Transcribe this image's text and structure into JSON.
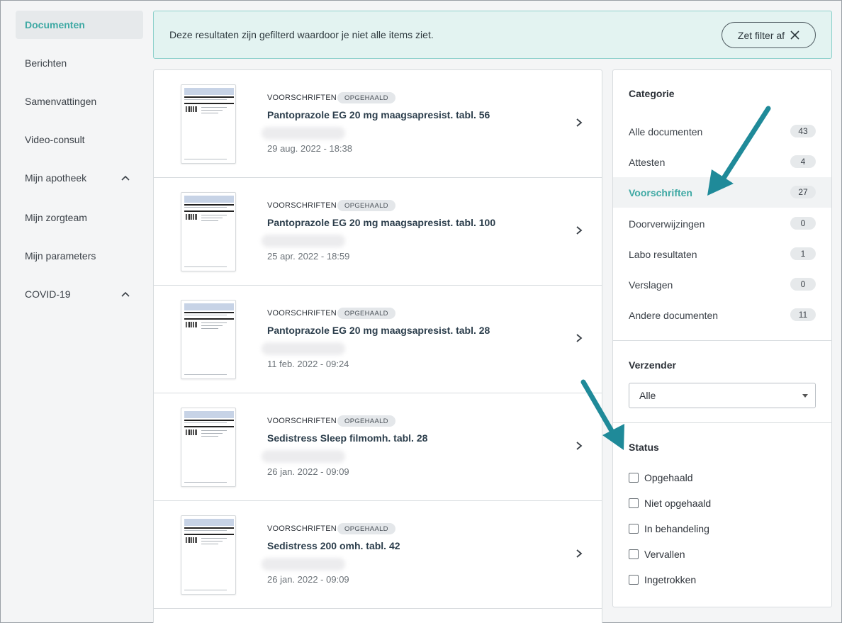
{
  "sidebar": {
    "items": [
      {
        "label": "Documenten",
        "active": true
      },
      {
        "label": "Berichten"
      },
      {
        "label": "Samenvattingen"
      },
      {
        "label": "Video-consult"
      },
      {
        "label": "Mijn apotheek",
        "expandable": true
      },
      {
        "label": "Mijn zorgteam"
      },
      {
        "label": "Mijn parameters"
      },
      {
        "label": "COVID-19",
        "expandable": true
      }
    ]
  },
  "banner": {
    "text": "Deze resultaten zijn gefilterd waardoor je niet alle items ziet.",
    "button_label": "Zet filter af"
  },
  "documents": [
    {
      "category": "VOORSCHRIFTEN",
      "status": "OPGEHAALD",
      "title": "Pantoprazole EG 20 mg maagsapresist. tabl. 56",
      "date": "29 aug. 2022 - 18:38"
    },
    {
      "category": "VOORSCHRIFTEN",
      "status": "OPGEHAALD",
      "title": "Pantoprazole EG 20 mg maagsapresist. tabl. 100",
      "date": "25 apr. 2022 - 18:59"
    },
    {
      "category": "VOORSCHRIFTEN",
      "status": "OPGEHAALD",
      "title": "Pantoprazole EG 20 mg maagsapresist. tabl. 28",
      "date": "11 feb. 2022 - 09:24"
    },
    {
      "category": "VOORSCHRIFTEN",
      "status": "OPGEHAALD",
      "title": "Sedistress Sleep filmomh. tabl. 28",
      "date": "26 jan. 2022 - 09:09"
    },
    {
      "category": "VOORSCHRIFTEN",
      "status": "OPGEHAALD",
      "title": "Sedistress 200 omh. tabl. 42",
      "date": "26 jan. 2022 - 09:09"
    }
  ],
  "filters": {
    "category_title": "Categorie",
    "categories": [
      {
        "label": "Alle documenten",
        "count": "43"
      },
      {
        "label": "Attesten",
        "count": "4"
      },
      {
        "label": "Voorschriften",
        "count": "27",
        "active": true
      },
      {
        "label": "Doorverwijzingen",
        "count": "0"
      },
      {
        "label": "Labo resultaten",
        "count": "1"
      },
      {
        "label": "Verslagen",
        "count": "0"
      },
      {
        "label": "Andere documenten",
        "count": "11"
      }
    ],
    "sender_title": "Verzender",
    "sender_value": "Alle",
    "status_title": "Status",
    "statuses": [
      "Opgehaald",
      "Niet opgehaald",
      "In behandeling",
      "Vervallen",
      "Ingetrokken"
    ]
  },
  "colors": {
    "accent": "#3fa9a4",
    "annotation_arrow": "#1f8a99",
    "banner_bg": "#e3f3f1"
  }
}
